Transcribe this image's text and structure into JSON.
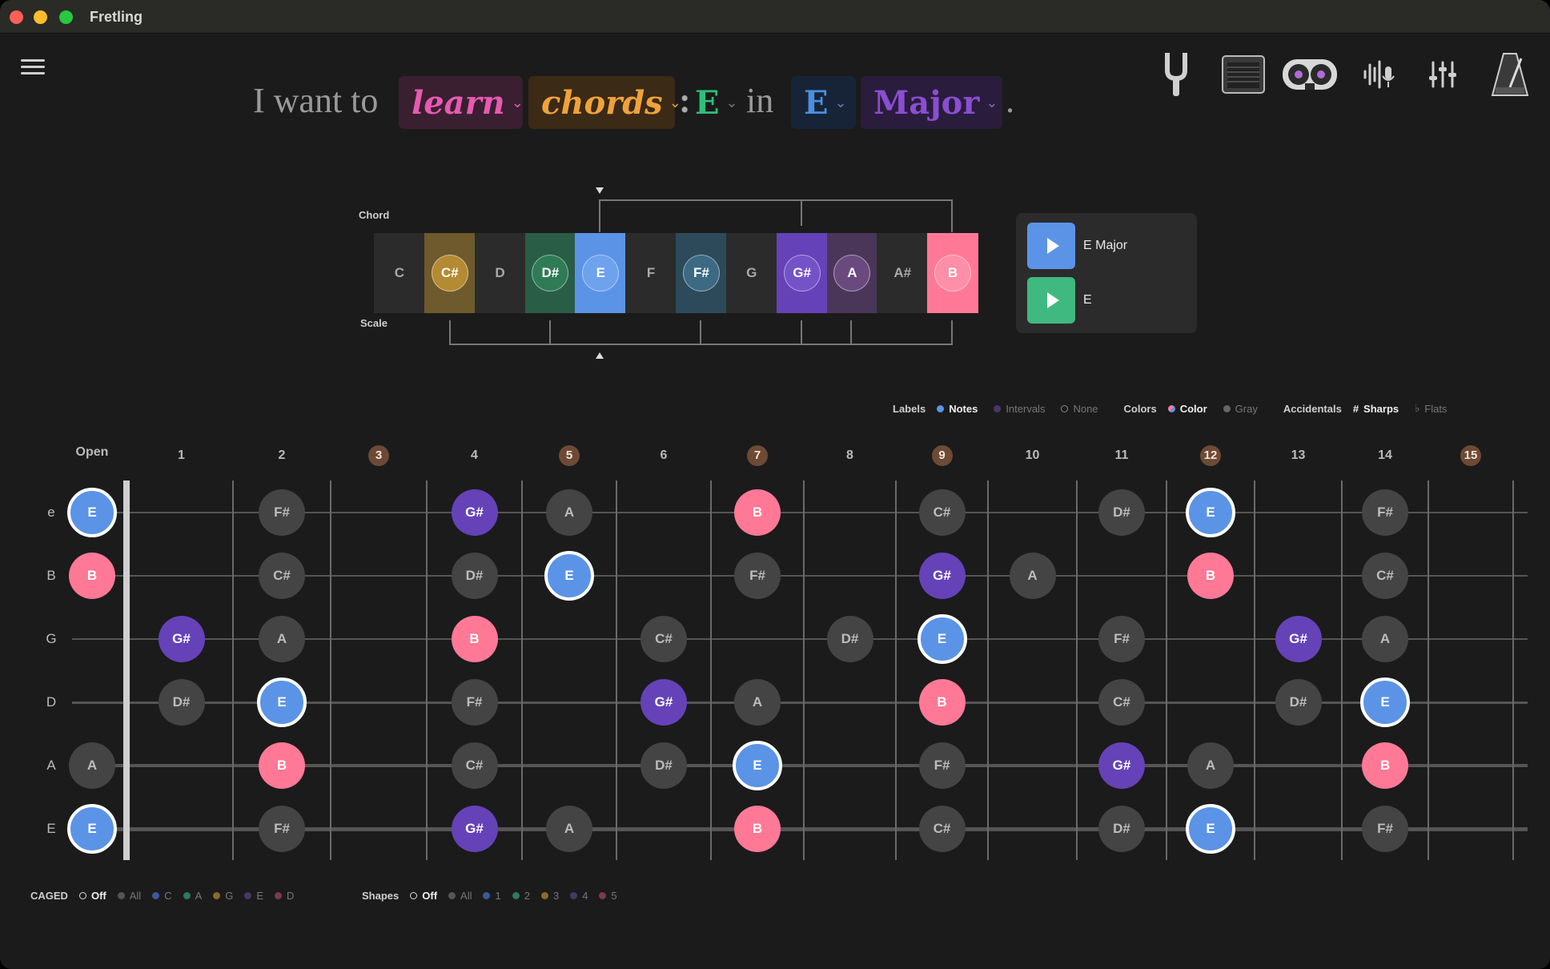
{
  "window": {
    "title": "Fretling"
  },
  "sentence": {
    "prefix": "I want to",
    "mode": "learn",
    "topic": "chords",
    "colon": ":",
    "chord_root": "E",
    "in_word": "in",
    "key_root": "E",
    "scale": "Major",
    "period": "."
  },
  "header_icons": [
    "tuning-fork-icon",
    "amplifier-icon",
    "tape-reel-icon",
    "microphone-waveform-icon",
    "mixer-sliders-icon",
    "metronome-icon"
  ],
  "strip": {
    "chord_label": "Chord",
    "scale_label": "Scale",
    "notes": [
      {
        "name": "C",
        "bg": "#2b2b2b",
        "ring": false
      },
      {
        "name": "C#",
        "bg": "#6e5a2c",
        "ring": true,
        "ring_bg": "#b48a33"
      },
      {
        "name": "D",
        "bg": "#2b2b2b",
        "ring": false
      },
      {
        "name": "D#",
        "bg": "#2a5d45",
        "ring": true,
        "ring_bg": "#2f7b56"
      },
      {
        "name": "E",
        "bg": "#5b94e6",
        "ring": true,
        "ring_bg": "#6ea2ec"
      },
      {
        "name": "F",
        "bg": "#2b2b2b",
        "ring": false
      },
      {
        "name": "F#",
        "bg": "#2d4a5a",
        "ring": true,
        "ring_bg": "#3b6a82"
      },
      {
        "name": "G",
        "bg": "#2b2b2b",
        "ring": false
      },
      {
        "name": "G#",
        "bg": "#6542b8",
        "ring": true,
        "ring_bg": "#7452c8"
      },
      {
        "name": "A",
        "bg": "#4a3658",
        "ring": true,
        "ring_bg": "#6a4a7e"
      },
      {
        "name": "A#",
        "bg": "#2b2b2b",
        "ring": false
      },
      {
        "name": "B",
        "bg": "#ff7996",
        "ring": true,
        "ring_bg": "#ff8ea8"
      }
    ]
  },
  "play": {
    "chord_label": "E Major",
    "note_label": "E",
    "chord_color": "#5b94e6",
    "note_color": "#3fb97f"
  },
  "label_options": {
    "labels_head": "Labels",
    "labels": [
      "Notes",
      "Intervals",
      "None"
    ],
    "colors_head": "Colors",
    "colors": [
      "Color",
      "Gray"
    ],
    "accidentals_head": "Accidentals",
    "accidentals": [
      "Sharps",
      "Flats"
    ],
    "accidental_glyphs": [
      "#",
      "♭"
    ]
  },
  "fretboard": {
    "open_label": "Open",
    "frets": [
      "1",
      "2",
      "3",
      "4",
      "5",
      "6",
      "7",
      "8",
      "9",
      "10",
      "11",
      "12",
      "13",
      "14",
      "15"
    ],
    "markers": [
      "3",
      "5",
      "7",
      "9",
      "12",
      "15"
    ],
    "strings": [
      "e",
      "B",
      "G",
      "D",
      "A",
      "E"
    ],
    "notes": [
      [
        "E",
        "",
        "F#",
        "",
        "G#",
        "A",
        "",
        "B",
        "",
        "C#",
        "",
        "D#",
        "E",
        "",
        "F#"
      ],
      [
        "B",
        "",
        "C#",
        "",
        "D#",
        "E",
        "",
        "F#",
        "",
        "G#",
        "A",
        "",
        "B",
        "",
        "C#"
      ],
      [
        "",
        "G#",
        "A",
        "",
        "B",
        "",
        "C#",
        "",
        "D#",
        "E",
        "",
        "F#",
        "",
        "G#",
        "A"
      ],
      [
        "",
        "D#",
        "E",
        "",
        "F#",
        "",
        "G#",
        "A",
        "",
        "B",
        "",
        "C#",
        "",
        "D#",
        "E"
      ],
      [
        "A",
        "",
        "B",
        "",
        "C#",
        "",
        "D#",
        "E",
        "",
        "F#",
        "",
        "G#",
        "A",
        "",
        "B"
      ],
      [
        "E",
        "",
        "F#",
        "",
        "G#",
        "A",
        "",
        "B",
        "",
        "C#",
        "",
        "D#",
        "E",
        "",
        "F#"
      ]
    ]
  },
  "caged": {
    "head": "CAGED",
    "items": [
      "Off",
      "All",
      "C",
      "A",
      "G",
      "E",
      "D"
    ]
  },
  "shapes": {
    "head": "Shapes",
    "items": [
      "Off",
      "All",
      "1",
      "2",
      "3",
      "4",
      "5"
    ]
  }
}
